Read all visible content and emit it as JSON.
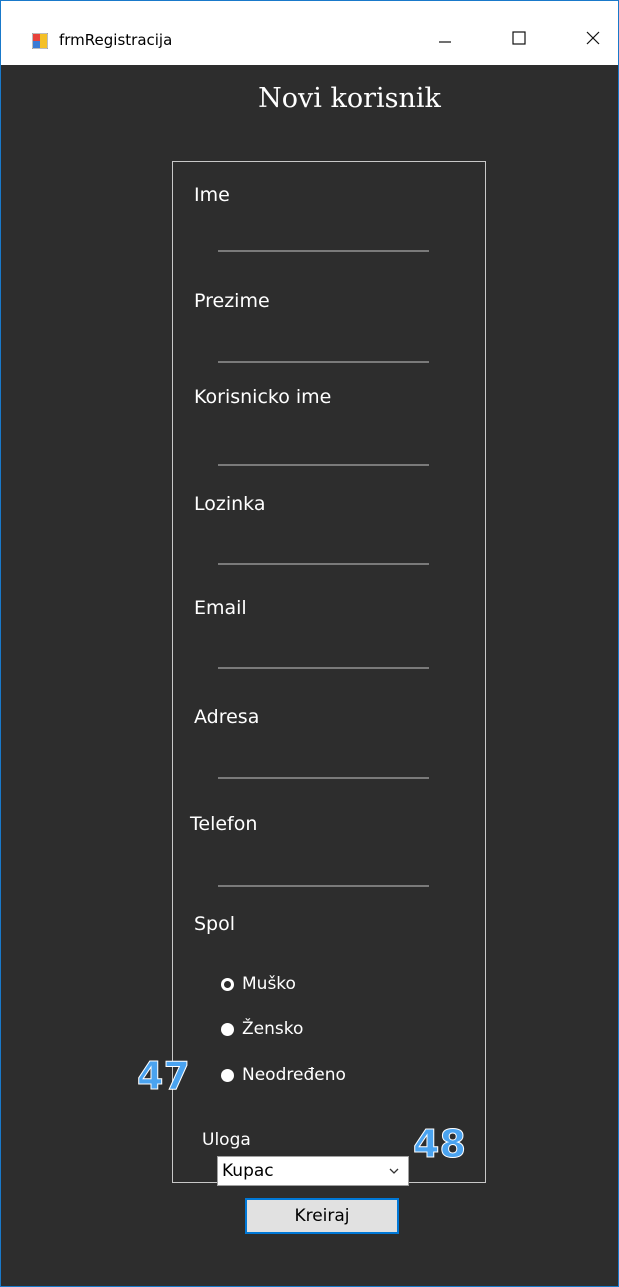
{
  "window": {
    "title": "frmRegistracija",
    "minimize_icon": "minimize-icon",
    "maximize_icon": "maximize-icon",
    "close_icon": "close-icon"
  },
  "form": {
    "heading": "Novi korisnik",
    "fields": [
      {
        "label": "Ime",
        "value": ""
      },
      {
        "label": "Prezime",
        "value": ""
      },
      {
        "label": "Korisnicko ime",
        "value": ""
      },
      {
        "label": "Lozinka",
        "value": ""
      },
      {
        "label": "Email",
        "value": ""
      },
      {
        "label": "Adresa",
        "value": ""
      },
      {
        "label": "Telefon",
        "value": ""
      }
    ],
    "gender": {
      "label": "Spol",
      "options": [
        "Muško",
        "Žensko",
        "Neodređeno"
      ],
      "selected": "Muško"
    },
    "role": {
      "label": "Uloga",
      "selected": "Kupac"
    },
    "submit_label": "Kreiraj"
  },
  "annotations": {
    "marker_1": "47",
    "marker_2": "48"
  },
  "colors": {
    "background": "#2d2d2d",
    "accent": "#0078d7",
    "marker": "#4aa3f0"
  }
}
